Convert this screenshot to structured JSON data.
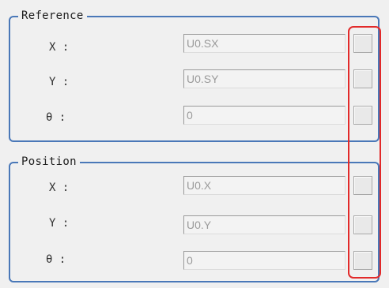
{
  "reference": {
    "title": "Reference",
    "rows": [
      {
        "label": "X :",
        "value": "U0.SX"
      },
      {
        "label": "Y :",
        "value": "U0.SY"
      },
      {
        "label": "θ :",
        "value": "0"
      }
    ]
  },
  "position": {
    "title": "Position",
    "rows": [
      {
        "label": "X :",
        "value": "U0.X"
      },
      {
        "label": "Y :",
        "value": "U0.Y"
      },
      {
        "label": "θ :",
        "value": "0"
      }
    ]
  },
  "colors": {
    "group_border": "#4a78b8",
    "highlight": "#e22a2a",
    "disabled_text": "#9a9a9a"
  }
}
